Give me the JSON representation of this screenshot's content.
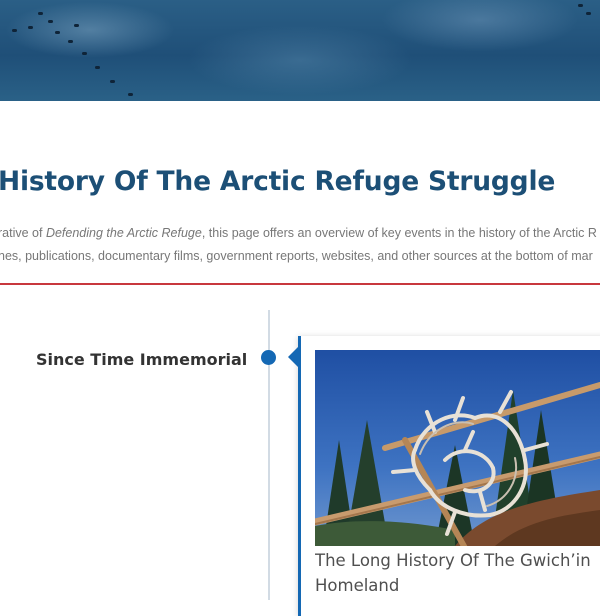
{
  "banner": {
    "image_name": "caribou-migration-aerial-photo"
  },
  "page": {
    "title": "History Of The Arctic Refuge Struggle",
    "intro_line1_pre": "rative of ",
    "intro_line1_em": "Defending the Arctic Refuge",
    "intro_line1_post": ", this page offers an overview of key events in the history of the Arctic R",
    "intro_line2": "nes, publications, documentary films, government reports, websites, and other sources at the bottom of mar"
  },
  "timeline": {
    "era_title": "Since Time Immemorial",
    "entries": [
      {
        "image_name": "caribou-antlers-on-fence-photo",
        "caption_line1": "The Long History Of The Gwich’in",
        "caption_line2": "Homeland"
      }
    ]
  },
  "colors": {
    "title": "#1c4f76",
    "accent_blue": "#1468b4",
    "divider_red": "#c8383e",
    "text_gray": "#777777"
  }
}
